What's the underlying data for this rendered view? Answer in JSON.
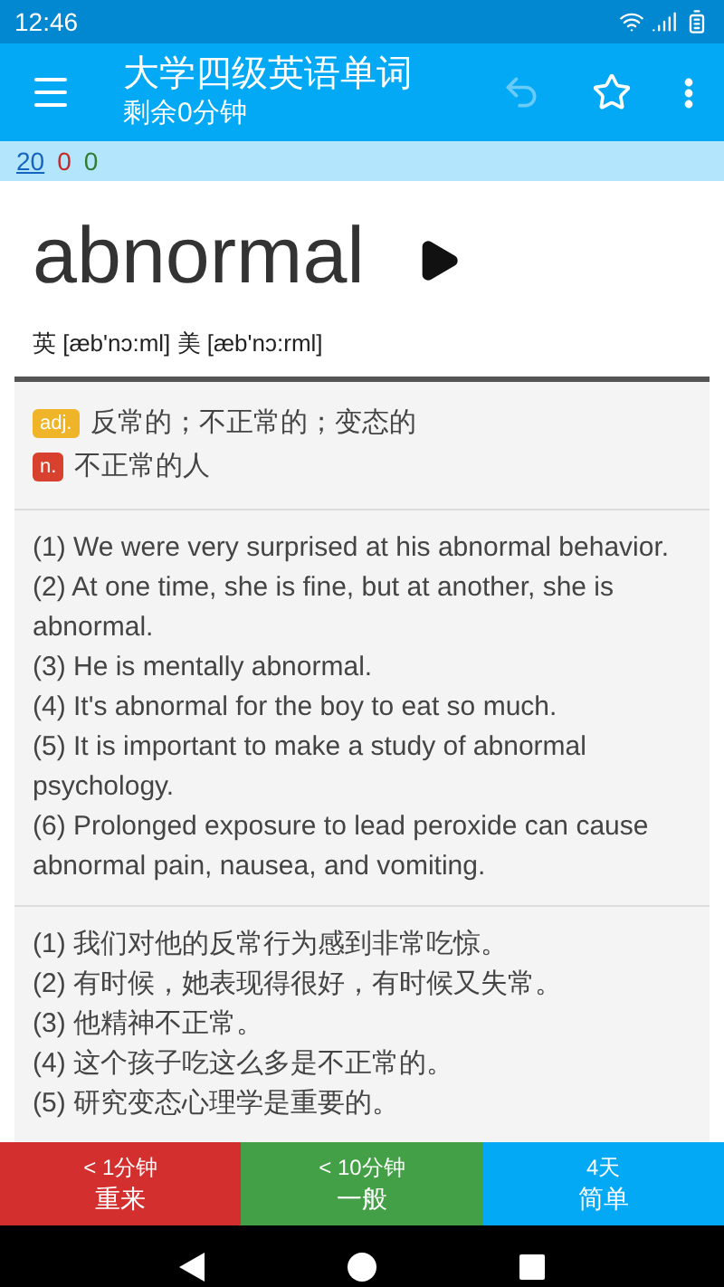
{
  "status_bar": {
    "time": "12:46"
  },
  "app_bar": {
    "title": "大学四级英语单词",
    "subtitle": "剩余0分钟",
    "undo_disabled": true
  },
  "counts": [
    {
      "value": "20",
      "color": "#1565c0",
      "selected": true
    },
    {
      "value": "0",
      "color": "#c62828",
      "selected": false
    },
    {
      "value": "0",
      "color": "#2e7d32",
      "selected": false
    }
  ],
  "word": {
    "text": "abnormal",
    "phonetic": "英 [æb'nɔ:ml] 美 [æb'nɔ:rml]"
  },
  "definitions": [
    {
      "pos": "adj.",
      "color": "#f0b429",
      "meaning": "反常的；不正常的；变态的"
    },
    {
      "pos": "n.",
      "color": "#d9412f",
      "meaning": "不正常的人"
    }
  ],
  "examples_en": [
    "(1) We were very surprised at his abnormal behavior.",
    "(2) At one time, she is fine, but at another, she is abnormal.",
    "(3) He is mentally abnormal.",
    "(4) It's abnormal for the boy to eat so much.",
    "(5) It is important to make a study of abnormal psychology.",
    "(6) Prolonged exposure to lead peroxide can cause abnormal pain, nausea, and vomiting."
  ],
  "examples_zh": [
    "(1) 我们对他的反常行为感到非常吃惊。",
    "(2) 有时候，她表现得很好，有时候又失常。",
    "(3) 他精神不正常。",
    "(4) 这个孩子吃这么多是不正常的。",
    "(5) 研究变态心理学是重要的。"
  ],
  "answer_buttons": [
    {
      "interval": "< 1分钟",
      "label": "重来",
      "color": "#d32f2f"
    },
    {
      "interval": "< 10分钟",
      "label": "一般",
      "color": "#43a047"
    },
    {
      "interval": "4天",
      "label": "简单",
      "color": "#03a9f4"
    }
  ]
}
